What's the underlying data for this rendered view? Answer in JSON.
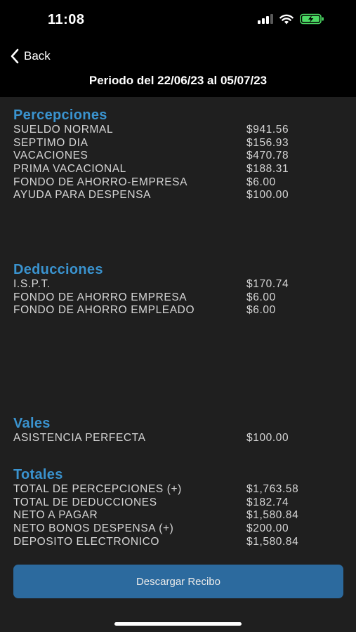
{
  "status_bar": {
    "time": "11:08"
  },
  "nav": {
    "back_label": "Back"
  },
  "period": "Periodo del 22/06/23 al 05/07/23",
  "colors": {
    "accent": "#3a93cf",
    "button": "#2c6a9e",
    "background": "#1f1f1f",
    "battery": "#4cd964"
  },
  "percepciones": {
    "title": "Percepciones",
    "rows": [
      {
        "label": "SUELDO NORMAL",
        "value": "$941.56"
      },
      {
        "label": "SEPTIMO DIA",
        "value": "$156.93"
      },
      {
        "label": "VACACIONES",
        "value": "$470.78"
      },
      {
        "label": "PRIMA VACACIONAL",
        "value": "$188.31"
      },
      {
        "label": "FONDO DE AHORRO-EMPRESA",
        "value": "$6.00"
      },
      {
        "label": "AYUDA PARA DESPENSA",
        "value": "$100.00"
      }
    ]
  },
  "deducciones": {
    "title": "Deducciones",
    "rows": [
      {
        "label": "I.S.P.T.",
        "value": "$170.74"
      },
      {
        "label": "FONDO DE AHORRO EMPRESA",
        "value": "$6.00"
      },
      {
        "label": "FONDO DE AHORRO EMPLEADO",
        "value": "$6.00"
      }
    ]
  },
  "vales": {
    "title": "Vales",
    "rows": [
      {
        "label": "ASISTENCIA PERFECTA",
        "value": "$100.00"
      }
    ]
  },
  "totales": {
    "title": "Totales",
    "rows": [
      {
        "label": "TOTAL DE PERCEPCIONES (+)",
        "value": "$1,763.58"
      },
      {
        "label": "TOTAL DE DEDUCCIONES",
        "value": "$182.74"
      },
      {
        "label": "NETO A PAGAR",
        "value": "$1,580.84"
      },
      {
        "label": "NETO BONOS DESPENSA (+)",
        "value": "$200.00"
      },
      {
        "label": "DEPOSITO ELECTRONICO",
        "value": "$1,580.84"
      }
    ]
  },
  "download_button": "Descargar Recibo"
}
